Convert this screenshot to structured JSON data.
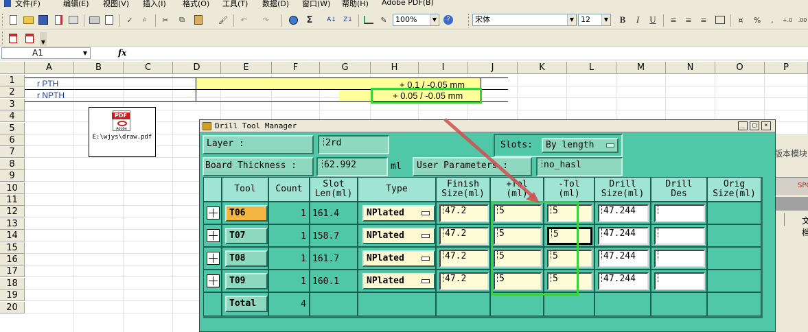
{
  "menu": [
    {
      "label": "文件(F)"
    },
    {
      "label": "编辑(E)"
    },
    {
      "label": "视图(V)"
    },
    {
      "label": "插入(I)"
    },
    {
      "label": "格式(O)"
    },
    {
      "label": "工具(T)"
    },
    {
      "label": "数据(D)"
    },
    {
      "label": "窗口(W)"
    },
    {
      "label": "帮助(H)"
    },
    {
      "label": "Adobe PDF(B)"
    }
  ],
  "toolbar": {
    "zoom": "100%",
    "font_name": "宋体",
    "font_size": "12",
    "bold": "B",
    "italic": "I",
    "underline": "U",
    "percent": "%",
    "comma": ",",
    "sigma": "Σ"
  },
  "formula_bar": {
    "name_box": "A1",
    "fx": "fx"
  },
  "sheet": {
    "columns": [
      "A",
      "B",
      "C",
      "D",
      "E",
      "F",
      "G",
      "H",
      "I",
      "J",
      "K",
      "L",
      "M",
      "N",
      "O",
      "P"
    ],
    "rows": [
      "1",
      "2",
      "3",
      "4",
      "5",
      "6",
      "7",
      "8",
      "9",
      "10",
      "11",
      "12",
      "13",
      "14",
      "15",
      "16",
      "17",
      "18",
      "19",
      "20"
    ],
    "cells": {
      "a1": "r PTH",
      "a2": "r NPTH",
      "h1": "+ 0.1 / -0.05 mm",
      "h2": "+ 0.05 / -0.05 mm"
    },
    "pdf_object": {
      "path": "E:\\wjys\\draw.pdf",
      "icon_label": "PDF",
      "icon_sublabel": "Adobe"
    }
  },
  "dialog": {
    "title": "Drill Tool Manager",
    "layer_label": "Layer          :",
    "layer_value": "2rd",
    "slots_label": "Slots:",
    "slots_value": "By length",
    "board_thickness_label": "Board Thickness :",
    "board_thickness_value": "62.992",
    "board_thickness_unit": "ml",
    "user_params_label": "User Parameters :",
    "user_params_value": "no_hasl",
    "columns": [
      {
        "l1": "",
        "l2": ""
      },
      {
        "l1": "Tool",
        "l2": ""
      },
      {
        "l1": "Count",
        "l2": ""
      },
      {
        "l1": "Slot",
        "l2": "Len(ml)"
      },
      {
        "l1": "Type",
        "l2": ""
      },
      {
        "l1": "Finish",
        "l2": "Size(ml)"
      },
      {
        "l1": "+Tol",
        "l2": "(ml)"
      },
      {
        "l1": "-Tol",
        "l2": "(ml)"
      },
      {
        "l1": "Drill",
        "l2": "Size(ml)"
      },
      {
        "l1": "Drill",
        "l2": "Des"
      },
      {
        "l1": "Orig",
        "l2": "Size(ml)"
      }
    ],
    "rows": [
      {
        "tool": "T06",
        "count": "1",
        "slot_len": "161.4",
        "type": "NPlated",
        "finish": "47.2",
        "plus_tol": "5",
        "minus_tol": "5",
        "drill": "47.244",
        "drill_des": ""
      },
      {
        "tool": "T07",
        "count": "1",
        "slot_len": "158.7",
        "type": "NPlated",
        "finish": "47.2",
        "plus_tol": "5",
        "minus_tol": "5",
        "drill": "47.244",
        "drill_des": ""
      },
      {
        "tool": "T08",
        "count": "1",
        "slot_len": "161.7",
        "type": "NPlated",
        "finish": "47.2",
        "plus_tol": "5",
        "minus_tol": "5",
        "drill": "47.244",
        "drill_des": ""
      },
      {
        "tool": "T09",
        "count": "1",
        "slot_len": "160.1",
        "type": "NPlated",
        "finish": "47.2",
        "plus_tol": "5",
        "minus_tol": "5",
        "drill": "47.244",
        "drill_des": ""
      }
    ],
    "total_label": "Total",
    "total_count": "4"
  },
  "right_pane": {
    "text1": "版本模块",
    "text2": "SPC",
    "text3": "文档"
  },
  "colors": {
    "dialog_bg": "#50c8a8",
    "highlight_green": "#3ad23a",
    "arrow": "#d05050",
    "cell_yellow": "#ffff99",
    "active_tool": "#f4b440"
  }
}
